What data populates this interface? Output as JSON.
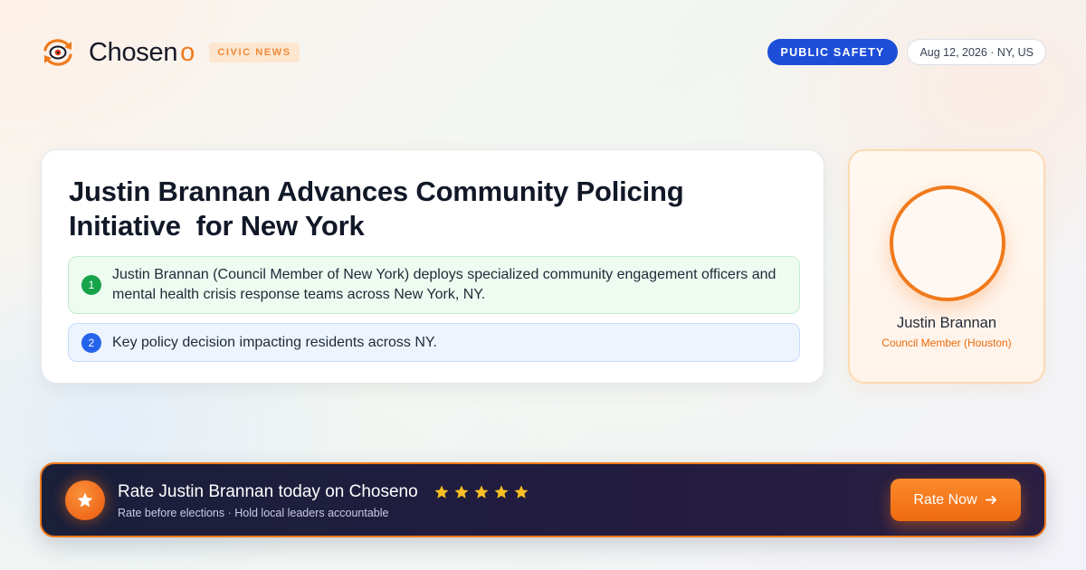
{
  "brand": {
    "name": "Chosen",
    "name_suffix": "o",
    "logo_icon": "eye-refresh-icon",
    "category_badge": "CIVIC NEWS",
    "accent_color": "#f07a1c"
  },
  "header": {
    "topic": "PUBLIC SAFETY",
    "topic_color": "#1d4ed8",
    "meta": "Aug 12, 2026 · NY, US"
  },
  "article": {
    "headline_line1": "Justin Brannan Advances Community Policing",
    "headline_line2": "Initiative  for New York",
    "points": [
      {
        "number": "1",
        "text": "Justin Brannan (Council Member of New York) deploys specialized community engagement officers and mental health crisis response teams across New York, NY.",
        "color": "#16a34a"
      },
      {
        "number": "2",
        "text": "Key policy decision impacting residents across NY.",
        "color": "#2563eb"
      }
    ]
  },
  "profile": {
    "name": "Justin Brannan",
    "role": "Council Member (Houston)"
  },
  "cta": {
    "icon": "star-icon",
    "title": "Rate Justin Brannan today on Choseno",
    "rating_stars": 5,
    "subtitle": "Rate before elections · Hold local leaders accountable",
    "button_label": "Rate Now",
    "button_icon": "arrow-right-icon"
  }
}
